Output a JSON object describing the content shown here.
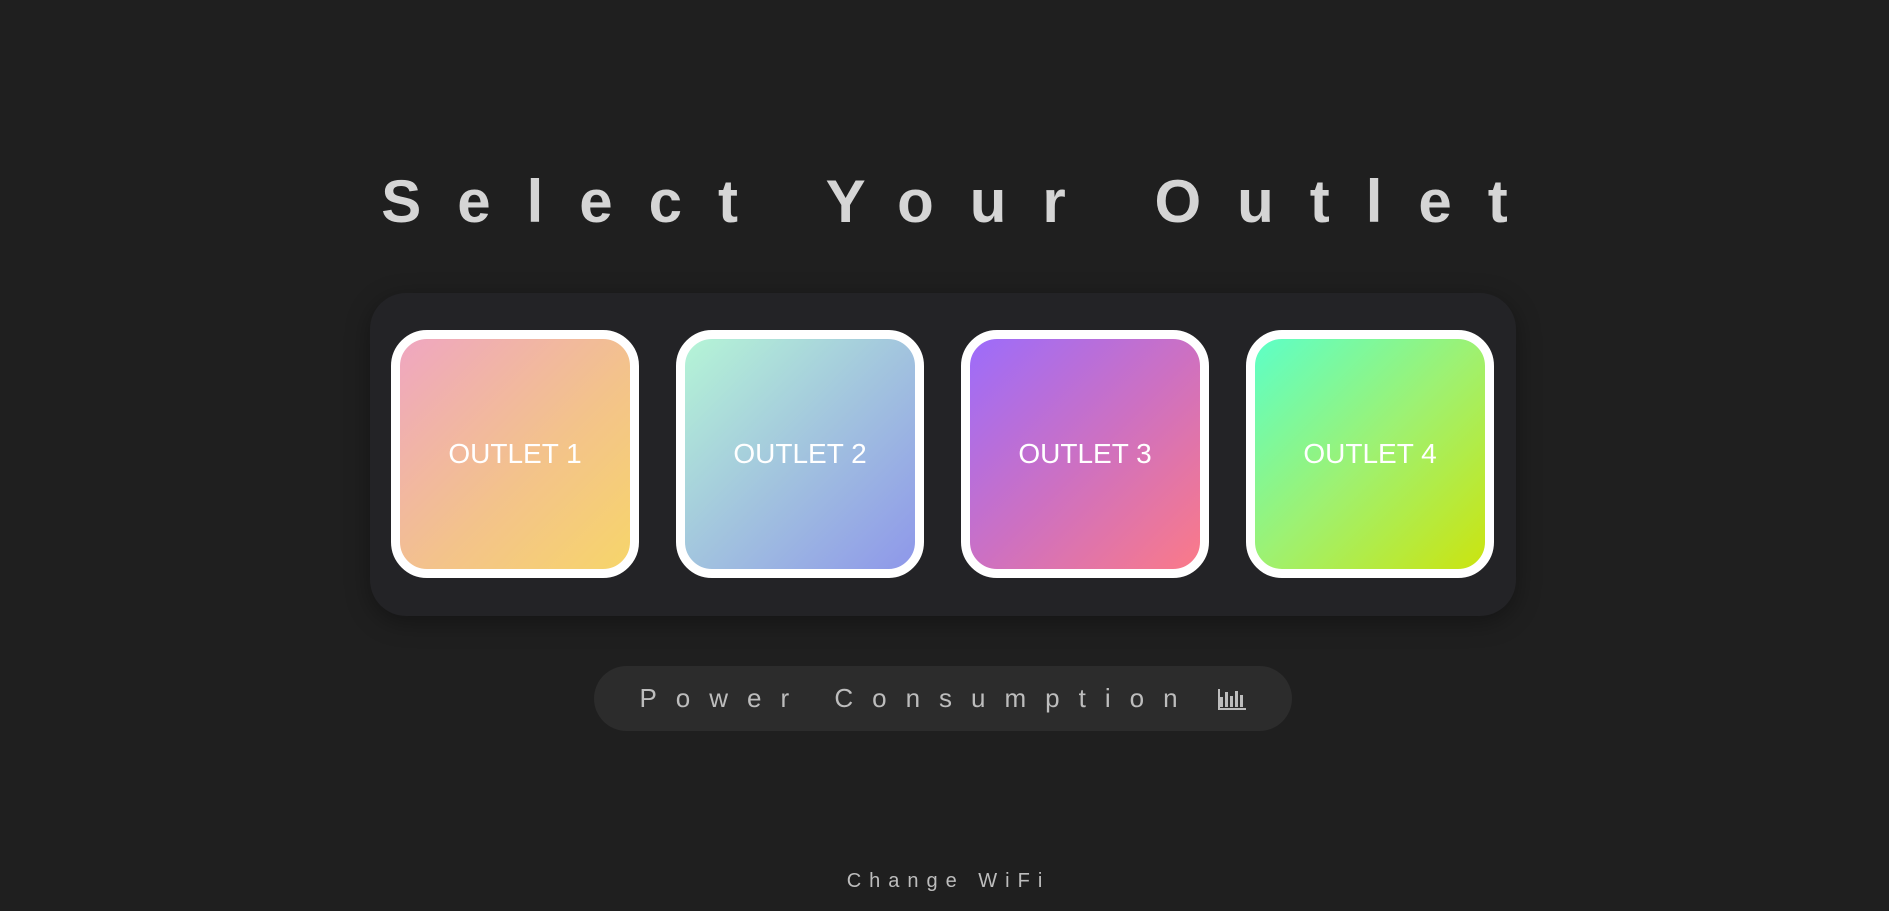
{
  "page": {
    "title": "Select Your Outlet"
  },
  "outlets": [
    {
      "label": "OUTLET 1"
    },
    {
      "label": "OUTLET 2"
    },
    {
      "label": "OUTLET 3"
    },
    {
      "label": "OUTLET 4"
    }
  ],
  "power_button": {
    "label": "Power Consumption",
    "icon": "bar-chart-icon"
  },
  "wifi_link": {
    "label": "Change WiFi"
  },
  "colors": {
    "background": "#1f1f1f",
    "panel": "#232326",
    "text": "#d5d5d5",
    "outlet_border": "#ffffff"
  }
}
